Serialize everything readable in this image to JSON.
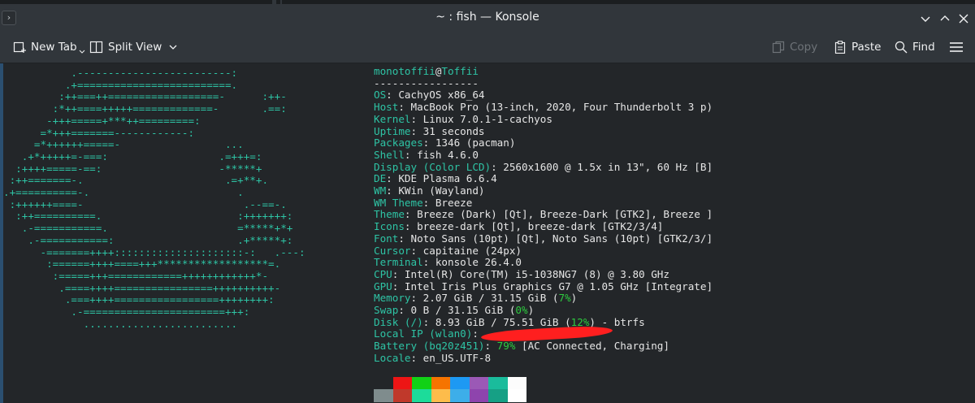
{
  "window": {
    "title": "~ : fish — Konsole"
  },
  "toolbar": {
    "new_tab": "New Tab",
    "split_view": "Split View",
    "copy": "Copy",
    "paste": "Paste",
    "find": "Find"
  },
  "icons": [
    "new-tab-icon",
    "split-view-icon",
    "chevron-down-icon",
    "copy-icon",
    "paste-icon",
    "search-icon",
    "hamburger-menu-icon",
    "minimize-icon",
    "maximize-icon",
    "close-icon",
    "sidebar-toggle-icon"
  ],
  "logo_lines": [
    "           .-------------------------:",
    "          .+=========================.",
    "         :++===++==================-      :++-",
    "        :*++====+++++=============-       .==:",
    "       -+++=====+***++=========:",
    "      =*+++=======------------:",
    "     =*++++++=====-                 ...",
    "   .+*+++++=-===:                  .=+++=:",
    "  :++++=====-==:                   -*****+",
    " :++=======-.                       .=+**+.",
    ".+==========-.                        .",
    " :++++++====-                          .--==-.",
    "  :++==========.                      :+++++++:",
    "   .-===========.                     =*****+*+",
    "    .-===========:                    .+*****+:",
    "      -=======++++:::::::::::::::::::::-:   .---:",
    "       :======++++====+++******************=.",
    "        :=====+++============++++++++++++*-",
    "         .====++++================++++++++++-",
    "          .===++++=================++++++++:",
    "           .-=======================+++:",
    "             ........................."
  ],
  "info": {
    "user": "monotoffii",
    "at": "@",
    "host": "Toffii",
    "separator": "-----------------",
    "rows": [
      {
        "label": "OS",
        "value": "CachyOS x86_64"
      },
      {
        "label": "Host",
        "value": "MacBook Pro (13-inch, 2020, Four Thunderbolt 3 p)"
      },
      {
        "label": "Kernel",
        "value": "Linux 7.0.1-1-cachyos"
      },
      {
        "label": "Uptime",
        "value": "31 seconds"
      },
      {
        "label": "Packages",
        "value": "1346 (pacman)"
      },
      {
        "label": "Shell",
        "value": "fish 4.6.0"
      },
      {
        "label": "Display (Color LCD)",
        "value": "2560x1600 @ 1.5x in 13\", 60 Hz [B]"
      },
      {
        "label": "DE",
        "value": "KDE Plasma 6.6.4"
      },
      {
        "label": "WM",
        "value": "KWin (Wayland)"
      },
      {
        "label": "WM Theme",
        "value": "Breeze"
      },
      {
        "label": "Theme",
        "value": "Breeze (Dark) [Qt], Breeze-Dark [GTK2], Breeze ]"
      },
      {
        "label": "Icons",
        "value": "breeze-dark [Qt], breeze-dark [GTK2/3/4]"
      },
      {
        "label": "Font",
        "value": "Noto Sans (10pt) [Qt], Noto Sans (10pt) [GTK2/3/]"
      },
      {
        "label": "Cursor",
        "value": "capitaine (24px)"
      },
      {
        "label": "Terminal",
        "value": "konsole 26.4.0"
      },
      {
        "label": "CPU",
        "value": "Intel(R) Core(TM) i5-1038NG7 (8) @ 3.80 GHz"
      },
      {
        "label": "GPU",
        "value": "Intel Iris Plus Graphics G7 @ 1.05 GHz [Integrate]"
      }
    ],
    "memory": {
      "label": "Memory",
      "pre": "2.07 GiB / 31.15 GiB (",
      "pct": "7%",
      "post": ")"
    },
    "swap": {
      "label": "Swap",
      "pre": "0 B / 31.15 GiB (",
      "pct": "0%",
      "post": ")"
    },
    "disk": {
      "label": "Disk (/)",
      "pre": "8.93 GiB / 75.51 GiB (",
      "pct": "12%",
      "post": ") - btrfs"
    },
    "local_ip": {
      "label": "Local IP (wlan0)",
      "value": ""
    },
    "battery": {
      "label": "Battery (bq20z451)",
      "pct": "79%",
      "post": " [AC Connected, Charging]"
    },
    "locale": {
      "label": "Locale",
      "value": "en_US.UTF-8"
    }
  },
  "palette": {
    "top": [
      "#232629",
      "#ed1515",
      "#11d116",
      "#f67400",
      "#1d99f3",
      "#9b59b6",
      "#1abc9c",
      "#fcfcfc"
    ],
    "bottom": [
      "#7f8c8d",
      "#c0392b",
      "#1cdc9a",
      "#fdbc4b",
      "#3daee9",
      "#8e44ad",
      "#16a085",
      "#ffffff"
    ]
  },
  "colors": {
    "label": "#2ec4a5",
    "percent_good": "#2ecc40",
    "text": "#e6e6e6",
    "background": "#232629"
  }
}
